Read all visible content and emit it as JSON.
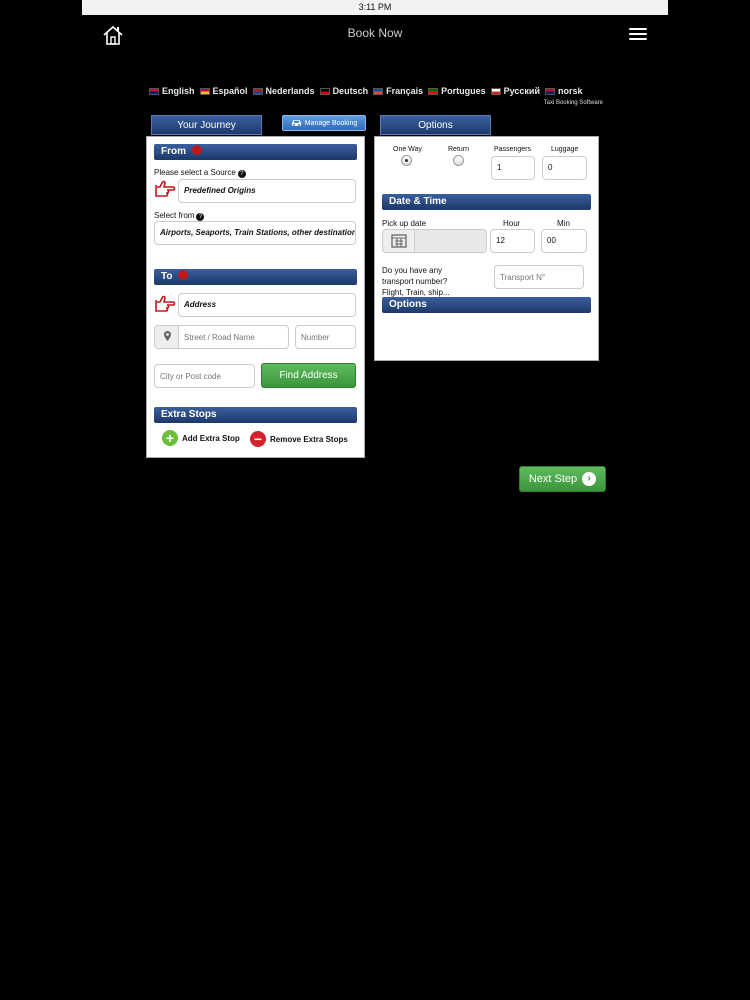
{
  "status_bar": {
    "time": "3:11 PM"
  },
  "topbar": {
    "title": "Book Now"
  },
  "languages": [
    {
      "label": "English",
      "colors": [
        "#c8102e",
        "#012169"
      ]
    },
    {
      "label": "Español",
      "colors": [
        "#c60b1e",
        "#ffc400"
      ]
    },
    {
      "label": "Nederlands",
      "colors": [
        "#ae1c28",
        "#21468b"
      ]
    },
    {
      "label": "Deutsch",
      "colors": [
        "#000000",
        "#dd0000"
      ]
    },
    {
      "label": "Français",
      "colors": [
        "#0055a4",
        "#ef4135"
      ]
    },
    {
      "label": "Portugues",
      "colors": [
        "#006600",
        "#ff0000"
      ]
    },
    {
      "label": "Русский",
      "colors": [
        "#ffffff",
        "#d52b1e"
      ]
    },
    {
      "label": "norsk",
      "colors": [
        "#ba0c2f",
        "#00205b"
      ]
    }
  ],
  "tagline": "Taxi Booking Software",
  "tabs": {
    "journey": "Your Journey",
    "manage": "Manage Booking",
    "options": "Options"
  },
  "from": {
    "header": "From",
    "source_label": "Please select a Source",
    "source_value": "Predefined Origins",
    "select_from_label": "Select from",
    "select_from_value": "Airports, Seaports, Train Stations, other destinations"
  },
  "to": {
    "header": "To",
    "type_value": "Address",
    "street_placeholder": "Street / Road Name",
    "number_placeholder": "Number",
    "city_placeholder": "City or Post code",
    "find_button": "Find Address"
  },
  "extra_stops": {
    "header": "Extra Stops",
    "add_label": "Add Extra Stop",
    "remove_label": "Remove Extra Stops"
  },
  "trip": {
    "one_way_label": "One Way",
    "return_label": "Return",
    "passengers_label": "Passengers",
    "passengers_value": "1",
    "luggage_label": "Luggage",
    "luggage_value": "0"
  },
  "datetime": {
    "header": "Date & Time",
    "pickup_label": "Pick up date",
    "hour_label": "Hour",
    "hour_value": "12",
    "min_label": "Min",
    "min_value": "00"
  },
  "transport": {
    "question_line1": "Do you have any",
    "question_line2": "transport number?",
    "question_line3": "Flight, Train, ship...",
    "placeholder": "Transport N°"
  },
  "options_header": "Options",
  "next_button": "Next Step",
  "colors": {
    "header_blue": "#1c3868",
    "green": "#3c963c",
    "required_red": "#c0181b"
  }
}
